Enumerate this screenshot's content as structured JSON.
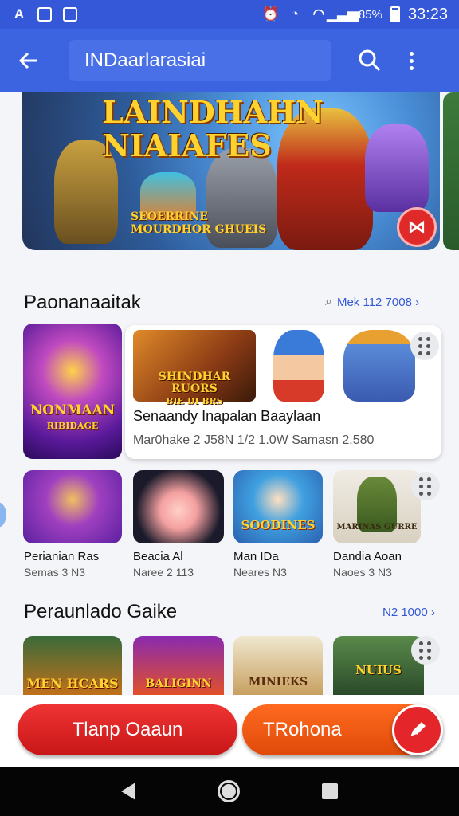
{
  "status_bar": {
    "left_icons": [
      "A",
      "☺",
      "▣"
    ],
    "time": "33:23",
    "battery_text": "85%"
  },
  "app_bar": {
    "search_value": "INDaarlarasiai"
  },
  "banner": {
    "title_line1": "LAINDHAHN",
    "title_line2": "NIAIAFES",
    "subtitle_line1": "SEOERRINE",
    "subtitle_line2": "MOURDHOR GHUEIS"
  },
  "section1": {
    "title": "Paonanaaitak",
    "link": "Mek 112 7008 ›",
    "featured": {
      "title": "Senaandy Inapalan Baaylaan",
      "meta": "Mar0hake 2 J58N 1/2 1.0W  Samasn 2.580",
      "image_text_line1": "SHINDHAR RUORS",
      "image_text_line2": "BIE DI BRS"
    },
    "side_tile_text_line1": "NONMAAN",
    "side_tile_text_line2": "RIBIDAGE",
    "games": [
      {
        "name": "Perianian Ras",
        "meta": "Semas 3 N3",
        "tile_text": ""
      },
      {
        "name": "Beacia Al",
        "meta": "Naree 2 113",
        "tile_text": ""
      },
      {
        "name": "Man IDa",
        "meta": "Neares N3",
        "tile_text": "SOODINES"
      },
      {
        "name": "Dandia Aoan",
        "meta": "Naoes 3 N3",
        "tile_text": "MARINAS GURRE"
      }
    ]
  },
  "section2": {
    "title": "Peraunlado Gaike",
    "link": "N2 1000 ›",
    "tiles": [
      "MEN HCARS",
      "BALIGINN",
      "MINIEKS",
      "NUIUS"
    ]
  },
  "buttons": {
    "primary": "Tlanp Oaaun",
    "secondary": "TRohona"
  },
  "colors": {
    "app_bar": "#3c63e0",
    "accent_red": "#e02929",
    "accent_orange": "#ff6a1f",
    "link": "#3558d8"
  }
}
